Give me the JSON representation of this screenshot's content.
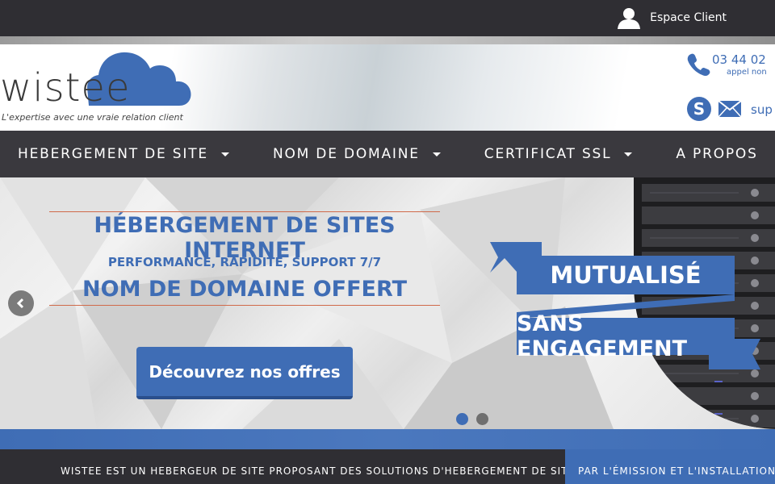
{
  "topbar": {
    "client_label": "Espace Client",
    "client_icon": "user-icon"
  },
  "header": {
    "logo_text": "wistee",
    "logo_tagline": "L'expertise avec une vraie relation client",
    "phone_number": "03 44 02",
    "phone_note": "appel non",
    "support_text": "sup",
    "icons": [
      "phone-icon",
      "skype-icon",
      "mail-icon"
    ]
  },
  "nav": {
    "items": [
      {
        "label": "HEBERGEMENT DE SITE"
      },
      {
        "label": "NOM DE DOMAINE"
      },
      {
        "label": "CERTIFICAT SSL"
      },
      {
        "label": "A PROPOS"
      }
    ]
  },
  "hero": {
    "title": "HÉBERGEMENT DE SITES INTERNET",
    "subtitle": "PERFORMANCE, RAPIDITÉ, SUPPORT 7/7",
    "offer": "NOM DE DOMAINE OFFERT",
    "cta_label": "Découvrez nos offres",
    "banner_1": "MUTUALISÉ",
    "banner_2": "SANS ENGAGEMENT",
    "slides": [
      "slide-1",
      "slide-2"
    ],
    "active_slide": 1
  },
  "footer": {
    "left_text": "WISTEE EST UN HEBERGEUR DE SITE PROPOSANT DES SOLUTIONS D'HEBERGEMENT DE SITES",
    "right_text": "PAR L'ÉMISSION ET L'INSTALLATION DE"
  },
  "colors": {
    "brand_blue": "#3f6db5",
    "dark_bar": "#2f2e33",
    "nav_bg": "#3a393e",
    "accent_line": "#d06a4a"
  }
}
